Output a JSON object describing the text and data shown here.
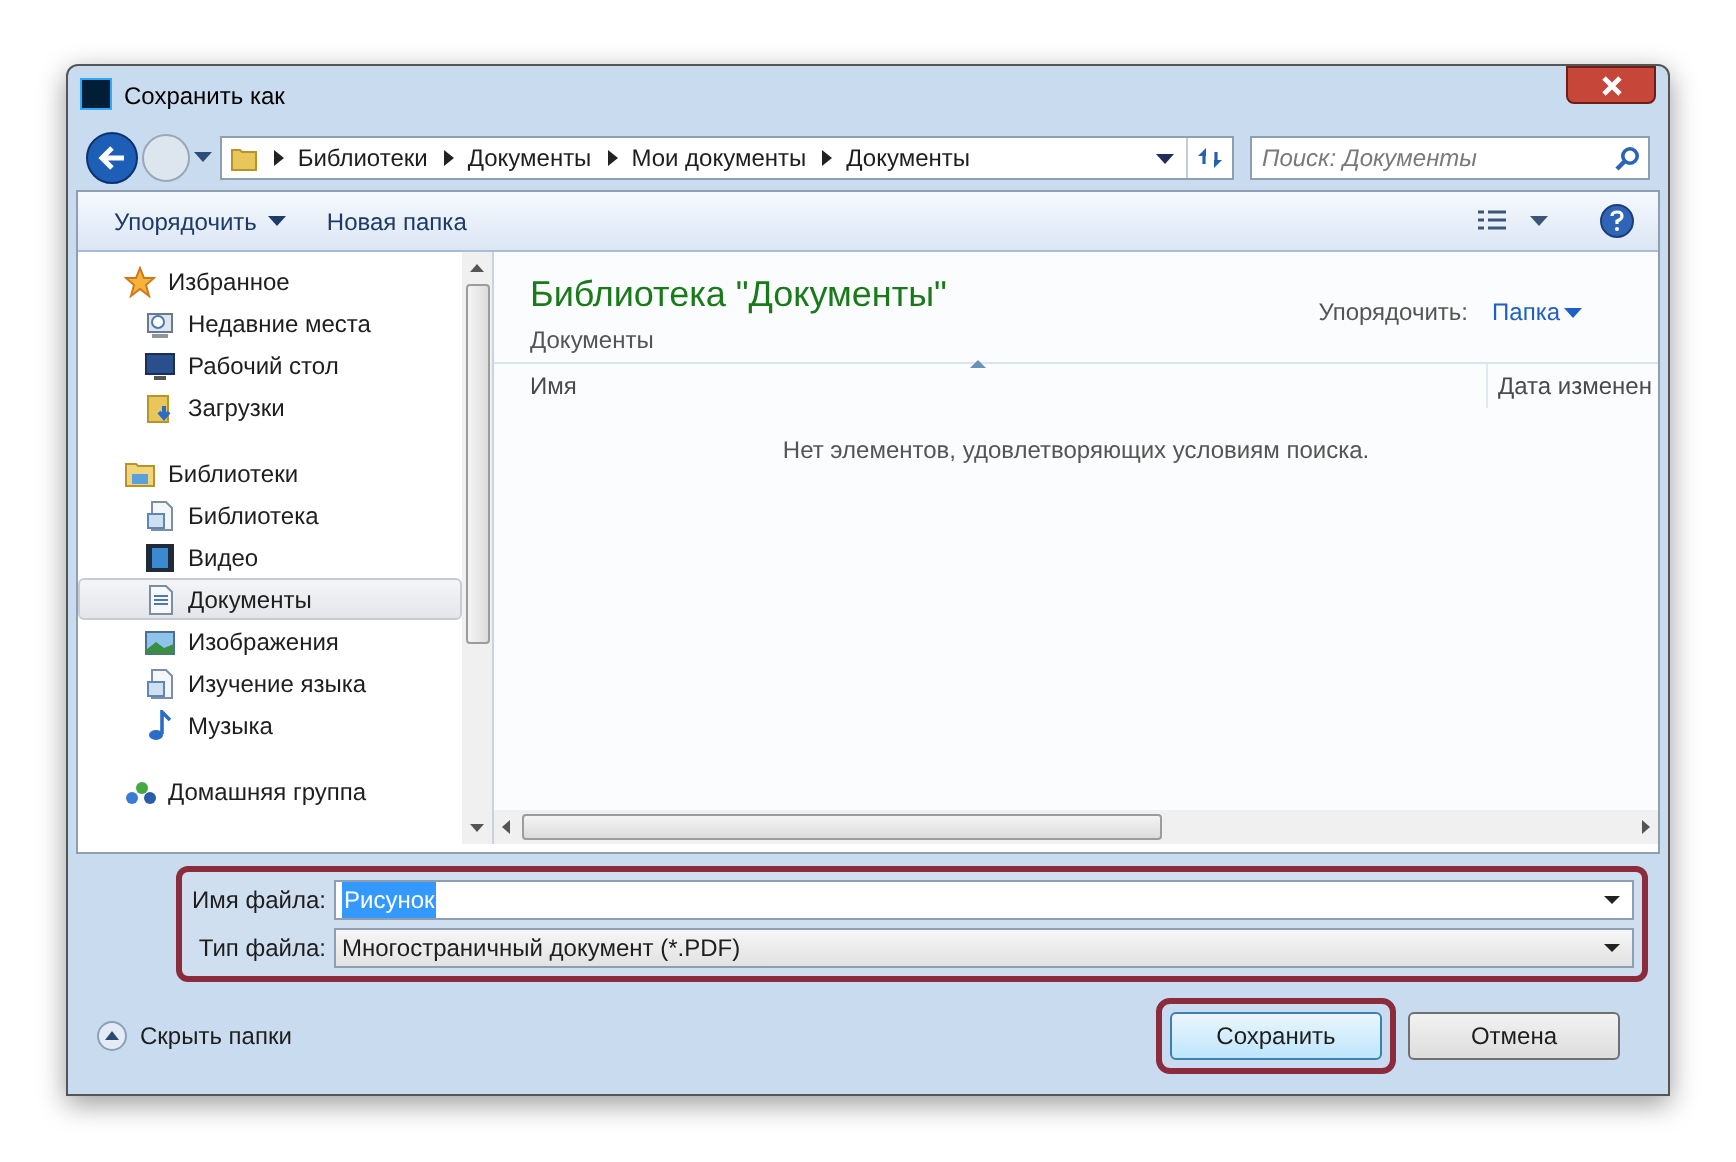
{
  "window": {
    "title": "Сохранить как"
  },
  "address": {
    "breadcrumb": [
      "Библиотеки",
      "Документы",
      "Мои документы",
      "Документы"
    ],
    "search_placeholder": "Поиск: Документы"
  },
  "toolbar": {
    "buttons": [
      {
        "label": "Упорядочить",
        "has_menu": true
      },
      {
        "label": "Новая папка",
        "has_menu": false
      }
    ]
  },
  "sidebar": {
    "groups": [
      {
        "label": "Избранное",
        "selected": false,
        "children": [
          {
            "label": "Недавние места",
            "selected": false
          },
          {
            "label": "Рабочий стол",
            "selected": false
          },
          {
            "label": "Загрузки",
            "selected": false
          }
        ]
      },
      {
        "label": "Библиотеки",
        "selected": false,
        "children": [
          {
            "label": "Библиотека",
            "selected": false
          },
          {
            "label": "Видео",
            "selected": false
          },
          {
            "label": "Документы",
            "selected": true
          },
          {
            "label": "Изображения",
            "selected": false
          },
          {
            "label": "Изучение языка",
            "selected": false
          },
          {
            "label": "Музыка",
            "selected": false
          }
        ]
      },
      {
        "label": "Домашняя группа",
        "selected": false
      }
    ]
  },
  "content": {
    "title": "Библиотека \"Документы\"",
    "subtitle": "Документы",
    "arrange_label": "Упорядочить:",
    "arrange_value": "Папка",
    "columns": [
      "Имя",
      "Дата изменен"
    ],
    "empty_message": "Нет элементов, удовлетворяющих условиям поиска."
  },
  "fields": [
    {
      "label": "Имя файла:",
      "value": "Рисунок",
      "text_selected": true
    },
    {
      "label": "Тип файла:",
      "value": "Многостраничный документ (*.PDF)",
      "text_selected": false
    }
  ],
  "hide_folders": "Скрыть папки",
  "buttons": [
    {
      "label": "Сохранить",
      "default": true
    },
    {
      "label": "Отмена",
      "default": false
    }
  ]
}
